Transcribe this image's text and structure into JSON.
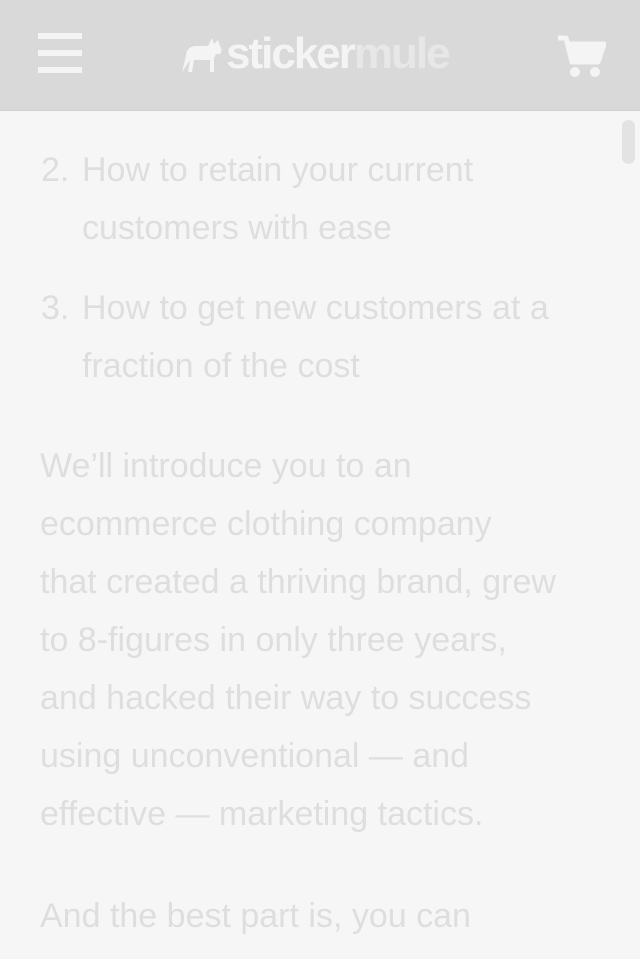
{
  "header": {
    "logo": {
      "brand_part1": "sticker",
      "brand_part2": "mule",
      "icon": "mule-icon"
    },
    "menu_icon": "hamburger-menu-icon",
    "cart_icon": "shopping-cart-icon"
  },
  "article": {
    "list_items": [
      {
        "number": "2.",
        "text_line1": "How to retain your current",
        "text_line2": "customers with ease"
      },
      {
        "number": "3.",
        "text_line1": "How to get new customers at a",
        "text_line2": "fraction of the cost"
      }
    ],
    "paragraph1_lines": [
      "We’ll introduce you to an",
      "ecommerce clothing company",
      "that created a thriving brand, grew",
      "to 8-figures in only three years,",
      "and hacked their way to success",
      "using unconventional — and",
      "effective — marketing tactics."
    ],
    "paragraph2_line1": "And the best part is, you can"
  },
  "colors": {
    "header_bg": "#d9d9d9",
    "page_bg": "#f6f6f6",
    "text": "#dedede",
    "icon": "#f4f4f4"
  }
}
